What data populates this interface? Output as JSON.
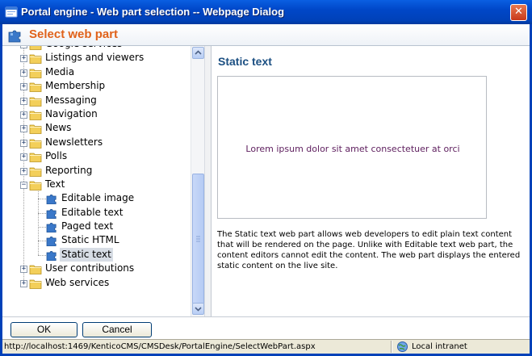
{
  "window": {
    "title": "Portal engine - Web part selection -- Webpage Dialog",
    "close_symbol": "✕"
  },
  "header": {
    "title": "Select web part",
    "icon": "puzzle-icon"
  },
  "tree": {
    "items": [
      {
        "label": "Google services",
        "kind": "folder",
        "expander": "+",
        "selected": false
      },
      {
        "label": "Listings and viewers",
        "kind": "folder",
        "expander": "+",
        "selected": false
      },
      {
        "label": "Media",
        "kind": "folder",
        "expander": "+",
        "selected": false
      },
      {
        "label": "Membership",
        "kind": "folder",
        "expander": "+",
        "selected": false
      },
      {
        "label": "Messaging",
        "kind": "folder",
        "expander": "+",
        "selected": false
      },
      {
        "label": "Navigation",
        "kind": "folder",
        "expander": "+",
        "selected": false
      },
      {
        "label": "News",
        "kind": "folder",
        "expander": "+",
        "selected": false
      },
      {
        "label": "Newsletters",
        "kind": "folder",
        "expander": "+",
        "selected": false
      },
      {
        "label": "Polls",
        "kind": "folder",
        "expander": "+",
        "selected": false
      },
      {
        "label": "Reporting",
        "kind": "folder",
        "expander": "+",
        "selected": false
      },
      {
        "label": "Text",
        "kind": "folder",
        "expander": "−",
        "selected": false
      },
      {
        "label": "Editable image",
        "kind": "webpart",
        "expander": "",
        "selected": false
      },
      {
        "label": "Editable text",
        "kind": "webpart",
        "expander": "",
        "selected": false
      },
      {
        "label": "Paged text",
        "kind": "webpart",
        "expander": "",
        "selected": false
      },
      {
        "label": "Static HTML",
        "kind": "webpart",
        "expander": "",
        "selected": false
      },
      {
        "label": "Static text",
        "kind": "webpart",
        "expander": "",
        "selected": true
      },
      {
        "label": "User contributions",
        "kind": "folder",
        "expander": "+",
        "selected": false
      },
      {
        "label": "Web services",
        "kind": "folder",
        "expander": "+",
        "selected": false
      }
    ]
  },
  "details": {
    "title": "Static text",
    "preview_text": "Lorem ipsum dolor sit amet consectetuer at orci",
    "description": "The Static text web part allows web developers to edit plain text content that will be rendered on the page. Unlike with Editable text web part, the content editors cannot edit the content. The web part displays the entered static content on the live site."
  },
  "buttons": {
    "ok_label": "OK",
    "cancel_label": "Cancel"
  },
  "statusbar": {
    "url": "http://localhost:1469/KenticoCMS/CMSDesk/PortalEngine/SelectWebPart.aspx",
    "zone": "Local intranet",
    "zone_icon": "intranet-globe-icon"
  },
  "colors": {
    "titlebar": "#0041b8",
    "header_title": "#e0621a",
    "pane_title": "#1b4f82",
    "preview_text": "#5d1d5d",
    "selection": "#d7dde5"
  }
}
